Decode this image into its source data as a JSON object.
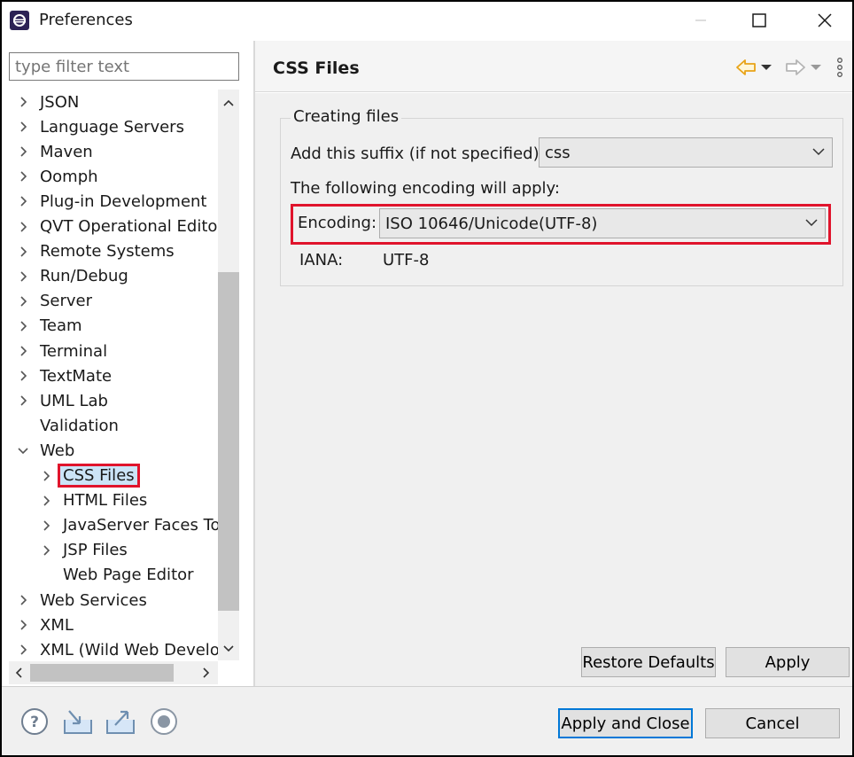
{
  "window": {
    "title": "Preferences"
  },
  "left": {
    "filter_placeholder": "type filter text",
    "tree": [
      {
        "label": "JSON",
        "level": 0,
        "chevron": "right"
      },
      {
        "label": "Language Servers",
        "level": 0,
        "chevron": "right"
      },
      {
        "label": "Maven",
        "level": 0,
        "chevron": "right"
      },
      {
        "label": "Oomph",
        "level": 0,
        "chevron": "right"
      },
      {
        "label": "Plug-in Development",
        "level": 0,
        "chevron": "right"
      },
      {
        "label": "QVT Operational Editor",
        "level": 0,
        "chevron": "right"
      },
      {
        "label": "Remote Systems",
        "level": 0,
        "chevron": "right"
      },
      {
        "label": "Run/Debug",
        "level": 0,
        "chevron": "right"
      },
      {
        "label": "Server",
        "level": 0,
        "chevron": "right"
      },
      {
        "label": "Team",
        "level": 0,
        "chevron": "right"
      },
      {
        "label": "Terminal",
        "level": 0,
        "chevron": "right"
      },
      {
        "label": "TextMate",
        "level": 0,
        "chevron": "right"
      },
      {
        "label": "UML Lab",
        "level": 0,
        "chevron": "right"
      },
      {
        "label": "Validation",
        "level": 0,
        "chevron": "none"
      },
      {
        "label": "Web",
        "level": 0,
        "chevron": "down"
      },
      {
        "label": "CSS Files",
        "level": 1,
        "chevron": "right",
        "selected": true
      },
      {
        "label": "HTML Files",
        "level": 1,
        "chevron": "right"
      },
      {
        "label": "JavaServer Faces Too",
        "level": 1,
        "chevron": "right"
      },
      {
        "label": "JSP Files",
        "level": 1,
        "chevron": "right"
      },
      {
        "label": "Web Page Editor",
        "level": 1,
        "chevron": "none"
      },
      {
        "label": "Web Services",
        "level": 0,
        "chevron": "right"
      },
      {
        "label": "XML",
        "level": 0,
        "chevron": "right"
      },
      {
        "label": "XML (Wild Web Develop",
        "level": 0,
        "chevron": "right"
      }
    ]
  },
  "right": {
    "title": "CSS Files",
    "group_label": "Creating files",
    "suffix_label": "Add this suffix (if not specified):",
    "suffix_value": "css",
    "encoding_note": "The following encoding will apply:",
    "encoding_label": "Encoding:",
    "encoding_value": "ISO 10646/Unicode(UTF-8)",
    "iana_label": "IANA:",
    "iana_value": "UTF-8",
    "restore_defaults": "Restore Defaults",
    "apply": "Apply"
  },
  "footer": {
    "apply_and_close": "Apply and Close",
    "cancel": "Cancel"
  },
  "colors": {
    "highlight": "#e0142c",
    "selection": "#cce4f7",
    "nav_back": "#e8a317",
    "primary_border": "#0078d7"
  }
}
